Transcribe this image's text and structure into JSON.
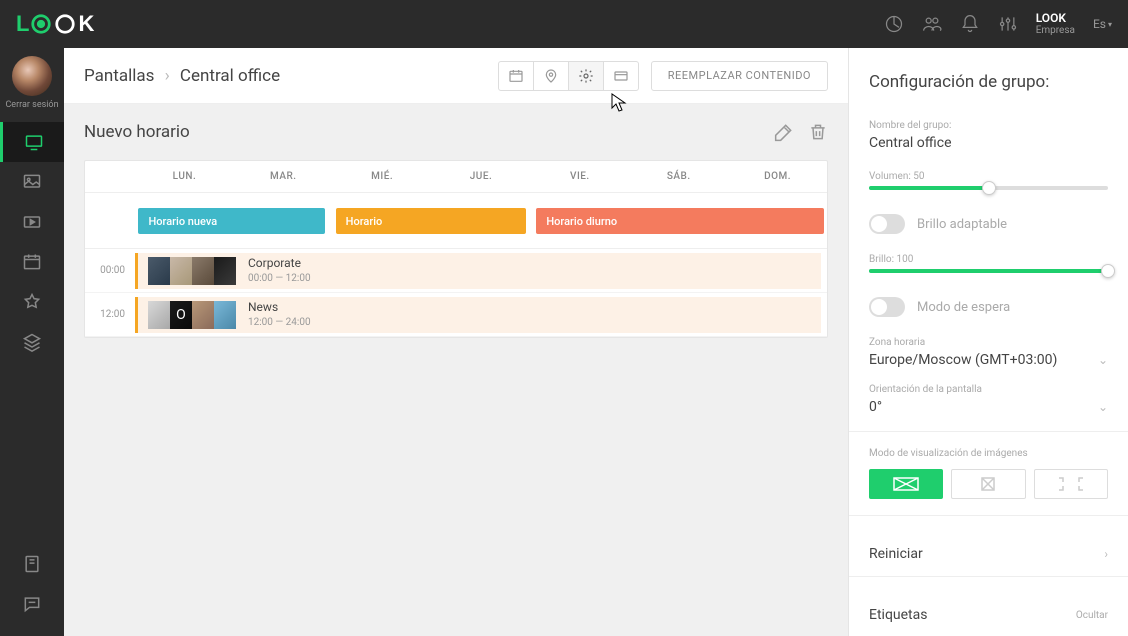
{
  "topbar": {
    "user_name": "LOOK",
    "user_sub": "Empresa",
    "lang": "Es"
  },
  "sidebar": {
    "logout_label": "Cerrar sesión"
  },
  "breadcrumb": {
    "root": "Pantallas",
    "current": "Central office"
  },
  "header": {
    "replace_label": "REEMPLAZAR CONTENIDO"
  },
  "content": {
    "title": "Nuevo horario",
    "days": [
      "LUN.",
      "MAR.",
      "MIÉ.",
      "JUE.",
      "VIE.",
      "SÁB.",
      "DOM."
    ],
    "bars": [
      {
        "label": "Horario nueva"
      },
      {
        "label": "Horario"
      },
      {
        "label": "Horario diurno"
      }
    ],
    "playlists": [
      {
        "time": "00:00",
        "name": "Corporate",
        "range": "00:00 — 12:00"
      },
      {
        "time": "12:00",
        "name": "News",
        "range": "12:00 — 24:00"
      }
    ]
  },
  "panel": {
    "title": "Configuración de grupo:",
    "group_name_label": "Nombre del grupo:",
    "group_name_value": "Central office",
    "volume_label": "Volumen: 50",
    "volume_pct": 50,
    "adaptive_brightness_label": "Brillo adaptable",
    "brightness_label": "Brillo: 100",
    "brightness_pct": 100,
    "standby_label": "Modo de espera",
    "timezone_label": "Zona horaria",
    "timezone_value": "Europe/Moscow (GMT+03:00)",
    "orientation_label": "Orientación de la pantalla",
    "orientation_value": "0°",
    "image_mode_label": "Modo de visualización de imágenes",
    "restart_label": "Reiniciar",
    "tags_label": "Etiquetas",
    "tags_action": "Ocultar"
  }
}
